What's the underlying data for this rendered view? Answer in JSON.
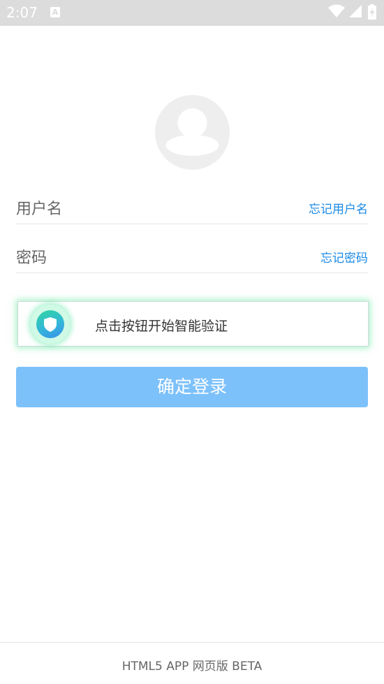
{
  "status_bar": {
    "time": "2:07",
    "notification_icon": "a-letter-icon",
    "icons": [
      "wifi-icon",
      "signal-icon",
      "battery-charging-icon"
    ]
  },
  "avatar": {
    "icon": "user-avatar-icon"
  },
  "form": {
    "username_label": "用户名",
    "forgot_username": "忘记用户名",
    "password_label": "密码",
    "forgot_password": "忘记密码"
  },
  "captcha": {
    "icon": "shield-icon",
    "prompt": "点击按钮开始智能验证"
  },
  "login_button": {
    "label": "确定登录",
    "color": "#7dc1fb"
  },
  "footer": {
    "text": "HTML5 APP 网页版 BETA"
  },
  "colors": {
    "link": "#1a8ae6",
    "status_bar": "#dcdcdc",
    "captcha_glow": "#58e696"
  }
}
